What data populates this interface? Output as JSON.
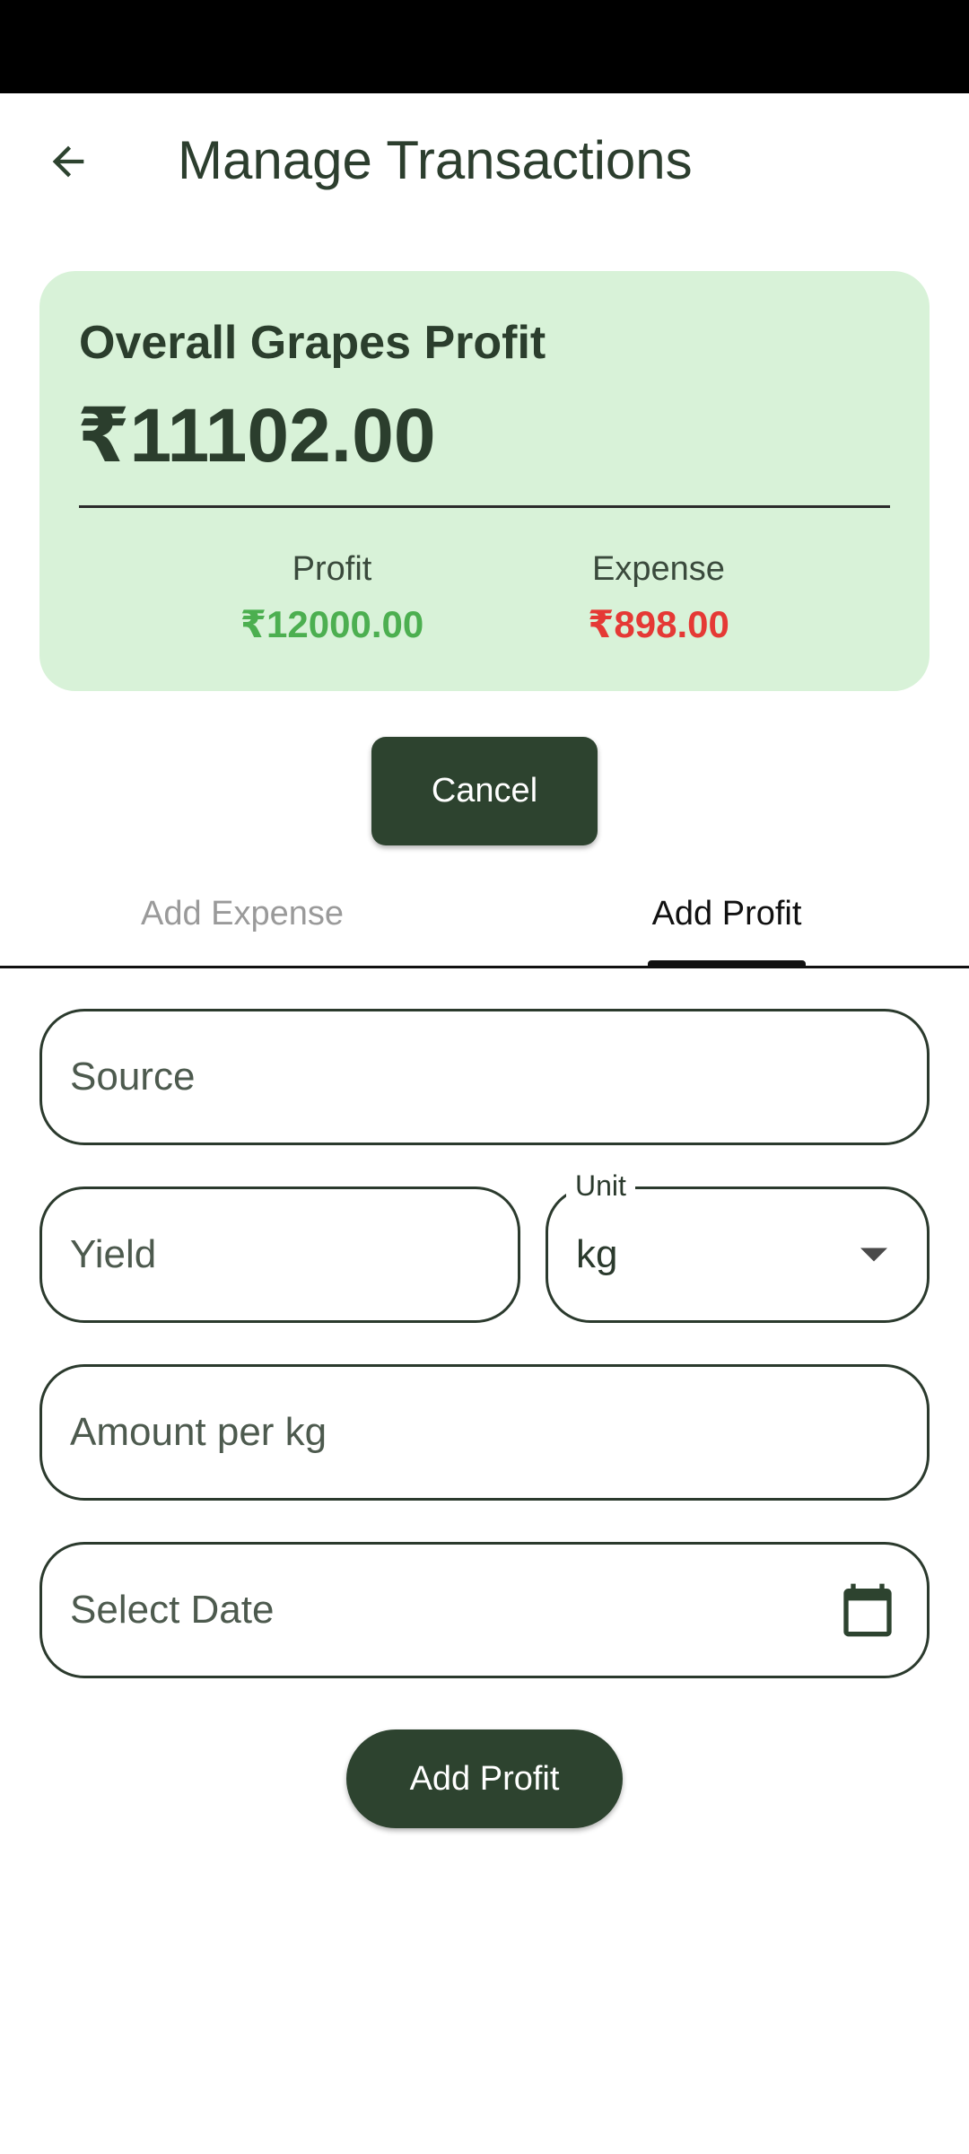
{
  "header": {
    "title": "Manage Transactions",
    "back_icon": "arrow-left-icon"
  },
  "summary": {
    "title": "Overall Grapes Profit",
    "total": "₹11102.00",
    "profit_label": "Profit",
    "profit_value": "₹12000.00",
    "expense_label": "Expense",
    "expense_value": "₹898.00"
  },
  "cancel_label": "Cancel",
  "tabs": [
    {
      "label": "Add Expense",
      "selected": false
    },
    {
      "label": "Add Profit",
      "selected": true
    }
  ],
  "form": {
    "source_placeholder": "Source",
    "yield_placeholder": "Yield",
    "unit_label": "Unit",
    "unit_value": "kg",
    "amount_placeholder": "Amount per kg",
    "date_placeholder": "Select Date",
    "date_icon": "calendar-icon",
    "submit_label": "Add Profit"
  },
  "colors": {
    "primary": "#2d432f",
    "card_background": "#d8f2d8",
    "profit": "#4caf50",
    "expense": "#e53935"
  }
}
